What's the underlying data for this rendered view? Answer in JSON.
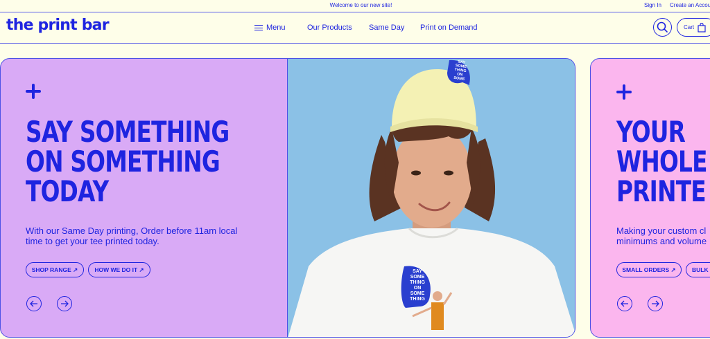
{
  "topbar": {
    "welcome": "Welcome to our new site!",
    "sign_in": "Sign In",
    "create_account": "Create an Accou"
  },
  "header": {
    "logo": "the print bar",
    "menu_label": "Menu",
    "nav": [
      "Our Products",
      "Same Day",
      "Print on Demand"
    ],
    "cart_label": "Cart"
  },
  "slides": [
    {
      "headline_lines": [
        "SAY SOMETHING",
        "ON SOMETHING",
        "TODAY"
      ],
      "description_lines": [
        "With our Same Day printing, Order before 11am local",
        "time to get your tee printed today."
      ],
      "buttons": [
        "SHOP RANGE ↗",
        "HOW WE DO IT ↗"
      ],
      "image": {
        "cap_lines": [
          "SAY",
          "SOME",
          "THING",
          "ON",
          "SOME",
          "THING"
        ],
        "shirt_lines": [
          "SAY",
          "SOME",
          "THING",
          "ON",
          "SOME",
          "THING"
        ]
      }
    },
    {
      "headline_lines": [
        "YOUR",
        "WHOLE",
        "PRINTE"
      ],
      "description_lines": [
        "Making your custom cl",
        "minimums and volume"
      ],
      "buttons": [
        "SMALL ORDERS ↗",
        "BULK O"
      ]
    }
  ],
  "colors": {
    "background": "#fefee9",
    "brand_blue": "#1e24e0",
    "slide1_bg": "#d9aaf6",
    "slide2_bg": "#fbb6ee",
    "photo_bg": "#8bc1e6"
  },
  "icons": [
    "hamburger-icon",
    "search-icon",
    "cart-bag-icon",
    "plus-icon",
    "arrow-left-icon",
    "arrow-right-icon",
    "external-arrow-icon"
  ]
}
